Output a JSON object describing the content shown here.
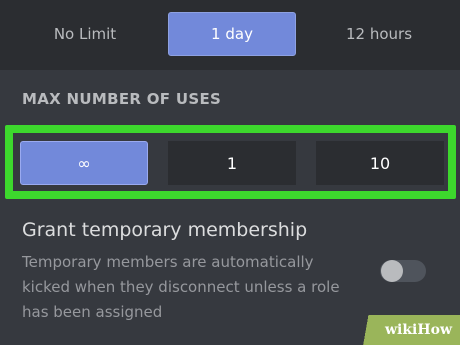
{
  "expire_after": {
    "options": [
      {
        "label": "No Limit",
        "selected": false
      },
      {
        "label": "1 day",
        "selected": true
      },
      {
        "label": "12 hours",
        "selected": false
      }
    ]
  },
  "max_uses": {
    "title": "MAX NUMBER OF USES",
    "options": [
      {
        "label": "∞",
        "selected": true
      },
      {
        "label": "1",
        "selected": false
      },
      {
        "label": "10",
        "selected": false
      }
    ]
  },
  "temporary_membership": {
    "title": "Grant temporary membership",
    "description": "Temporary members are automatically kicked when they disconnect unless a role has been assigned",
    "enabled": false
  },
  "watermark": {
    "text": "wikiHow"
  },
  "colors": {
    "accent": "#7289da",
    "highlight": "#3dd82d",
    "background": "#36393f"
  }
}
